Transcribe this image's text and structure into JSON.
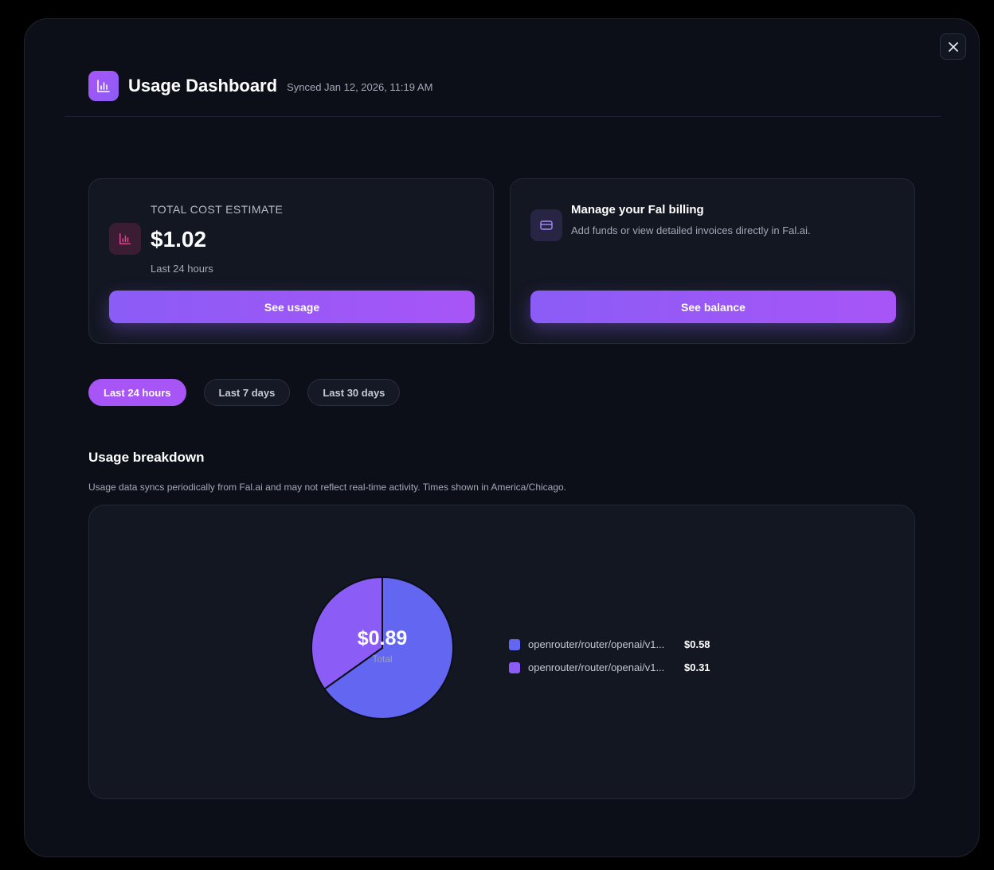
{
  "header": {
    "title": "Usage Dashboard",
    "synced": "Synced Jan 12, 2026, 11:19 AM"
  },
  "cost_card": {
    "label": "TOTAL COST ESTIMATE",
    "amount": "$1.02",
    "period": "Last 24 hours",
    "button_label": "See usage"
  },
  "billing_card": {
    "title": "Manage your Fal billing",
    "description": "Add funds or view detailed invoices directly in Fal.ai.",
    "button_label": "See balance"
  },
  "range_tabs": [
    {
      "label": "Last 24 hours",
      "active": true
    },
    {
      "label": "Last 7 days",
      "active": false
    },
    {
      "label": "Last 30 days",
      "active": false
    }
  ],
  "breakdown": {
    "title": "Usage breakdown",
    "note": "Usage data syncs periodically from Fal.ai and may not reflect real-time activity. Times shown in America/Chicago.",
    "center_value": "$0.89",
    "center_label": "Total"
  },
  "chart_data": {
    "type": "pie",
    "categories": [
      "openrouter/router/openai/v1...",
      "openrouter/router/openai/v1..."
    ],
    "values": [
      0.58,
      0.31
    ],
    "value_labels": [
      "$0.58",
      "$0.31"
    ],
    "colors": [
      "#6366f1",
      "#8b5cf6"
    ]
  },
  "colors": {
    "accent": "#a855f7",
    "accent_secondary": "#8b5cf6",
    "background": "#0c0f17",
    "card": "#131722"
  }
}
